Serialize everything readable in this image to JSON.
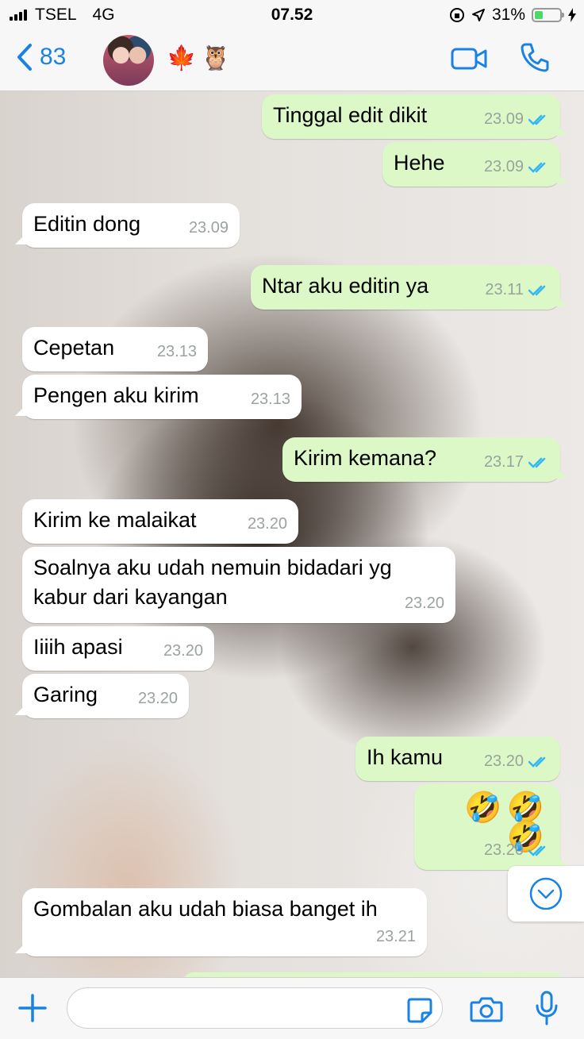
{
  "status_bar": {
    "carrier": "TSEL",
    "network": "4G",
    "time": "07.52",
    "battery_percent": "31%"
  },
  "header": {
    "back_count": "83",
    "contact_emojis": "🍁🦉"
  },
  "messages": [
    {
      "side": "out",
      "text": "Tinggal edit dikit",
      "time": "23.09",
      "read": true
    },
    {
      "side": "out",
      "text": "Hehe",
      "time": "23.09",
      "read": true
    },
    {
      "side": "in",
      "text": "Editin dong",
      "time": "23.09"
    },
    {
      "side": "out",
      "text": "Ntar aku editin ya",
      "time": "23.11",
      "read": true
    },
    {
      "side": "in",
      "text": "Cepetan",
      "time": "23.13"
    },
    {
      "side": "in",
      "text": "Pengen aku kirim",
      "time": "23.13"
    },
    {
      "side": "out",
      "text": "Kirim kemana?",
      "time": "23.17",
      "read": true
    },
    {
      "side": "in",
      "text": "Kirim ke malaikat",
      "time": "23.20"
    },
    {
      "side": "in",
      "text": "Soalnya aku udah nemuin bidadari yg kabur dari kayangan",
      "line1": "Soalnya aku udah nemuin bidadari yg",
      "line2": "kabur dari kayangan",
      "time": "23.20"
    },
    {
      "side": "in",
      "text": "Iiiih apasi",
      "time": "23.20"
    },
    {
      "side": "in",
      "text": "Garing",
      "time": "23.20"
    },
    {
      "side": "out",
      "text": "Ih kamu",
      "time": "23.20",
      "read": true
    },
    {
      "side": "out",
      "text": "🤣🤣🤣",
      "time": "23.20",
      "read": true
    },
    {
      "side": "in",
      "text": "Gombalan aku udah biasa banget ih",
      "time": "23.21"
    }
  ],
  "input": {
    "placeholder": ""
  },
  "colors": {
    "accent": "#1a82e2",
    "outgoing_bubble": "#dcf8c6",
    "incoming_bubble": "#ffffff",
    "read_tick": "#34b7f1"
  },
  "icons": [
    "back-chevron-icon",
    "video-call-icon",
    "phone-icon",
    "plus-icon",
    "sticker-icon",
    "camera-icon",
    "microphone-icon",
    "chevron-down-icon",
    "double-check-icon"
  ]
}
